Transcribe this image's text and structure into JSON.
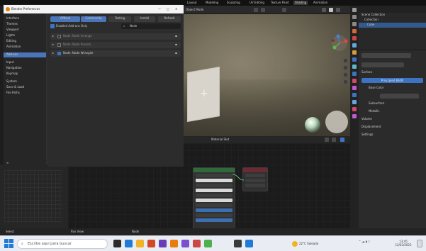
{
  "window": {
    "title": "Blender Preferences"
  },
  "topbar": {
    "workspaces": [
      "Layout",
      "Modeling",
      "Sculpting",
      "UV Editing",
      "Texture Paint",
      "Shading",
      "Animation"
    ]
  },
  "viewport": {
    "header_label": "Object Mode",
    "footer_label": "Material Slot"
  },
  "preferences": {
    "title": "Blender Preferences",
    "sidebar_groups": [
      [
        "Interface",
        "Themes",
        "Viewport",
        "Lights",
        "Editing",
        "Animation"
      ],
      [
        "Add-ons"
      ],
      [
        "Input",
        "Navigation",
        "Keymap"
      ],
      [
        "System",
        "Save & Load",
        "File Paths"
      ]
    ],
    "active_item": "Add-ons",
    "tabs": [
      "Official",
      "Community",
      "Testing",
      "Install",
      "Refresh"
    ],
    "search_placeholder": "Enabled Add-ons Only",
    "filter_value": "Node",
    "addons": [
      "Node: Node Arrange",
      "Node: Node Presets",
      "Node: Node Wrangler"
    ]
  },
  "outliner": {
    "rows": [
      "Scene Collection",
      "Collection",
      "Cube"
    ],
    "selected_index": 2
  },
  "properties": {
    "items": [
      "Surface",
      "Principled BSDF",
      "Base Color",
      "Subsurface",
      "Metallic",
      "Volume",
      "Displacement",
      "Settings"
    ]
  },
  "statusbar": {
    "left": "Select",
    "middle": "Pan View",
    "right": "Node"
  },
  "taskbar": {
    "search_placeholder": "Escribe aquí para buscar",
    "weather": "22°C Soleado",
    "time": "13:45",
    "date": "12/03/2023"
  },
  "colors": {
    "accent": "#4a75b8",
    "outliner_selected": "#335a8e",
    "node_green": "#2f6b3a",
    "node_red": "#6b2b35"
  }
}
